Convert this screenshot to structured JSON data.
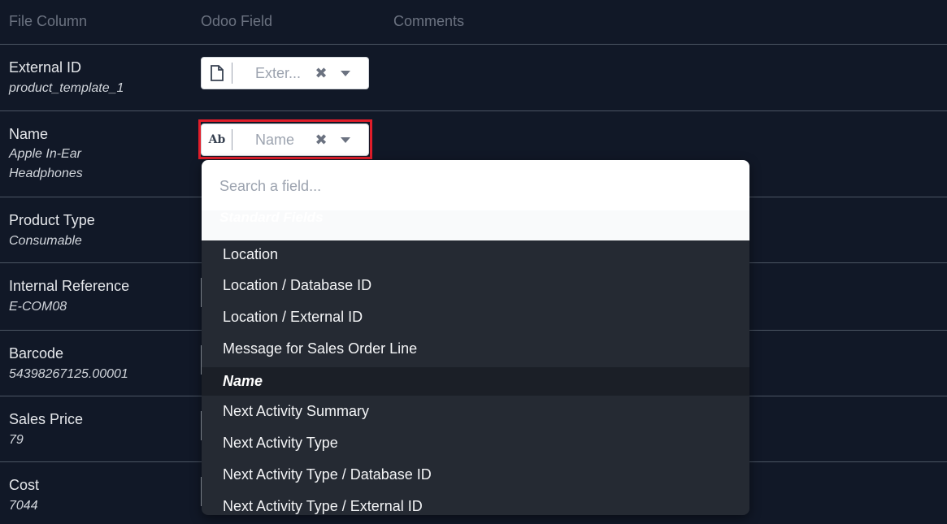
{
  "header": {
    "file_column": "File Column",
    "odoo_field": "Odoo Field",
    "comments": "Comments"
  },
  "rows": [
    {
      "label": "External ID",
      "sample": "product_template_1",
      "field": "Exter...",
      "field_icon": "document-icon"
    },
    {
      "label": "Name",
      "sample": "Apple In-Ear Headphones",
      "field": "Name",
      "field_icon": "text-type-icon",
      "icon_text": "Ab"
    },
    {
      "label": "Product Type",
      "sample": "Consumable"
    },
    {
      "label": "Internal Reference",
      "sample": "E-COM08"
    },
    {
      "label": "Barcode",
      "sample": "54398267125.00001"
    },
    {
      "label": "Sales Price",
      "sample": "79"
    },
    {
      "label": "Cost",
      "sample": "7044"
    }
  ],
  "dropdown": {
    "search_placeholder": "Search a field...",
    "group_label": "Standard Fields",
    "items": [
      {
        "label": "Location"
      },
      {
        "label": "Location / Database ID"
      },
      {
        "label": "Location / External ID"
      },
      {
        "label": "Message for Sales Order Line"
      },
      {
        "label": "Name",
        "selected": true
      },
      {
        "label": "Next Activity Summary"
      },
      {
        "label": "Next Activity Type"
      },
      {
        "label": "Next Activity Type / Database ID"
      },
      {
        "label": "Next Activity Type / External ID"
      }
    ]
  },
  "icons": {
    "clear": "close-icon",
    "caret": "chevron-down-icon"
  },
  "colors": {
    "background": "#111827",
    "highlight": "#e11d2a",
    "dropdown_bg": "#252a33",
    "selected_item_bg": "#1b1f27"
  }
}
